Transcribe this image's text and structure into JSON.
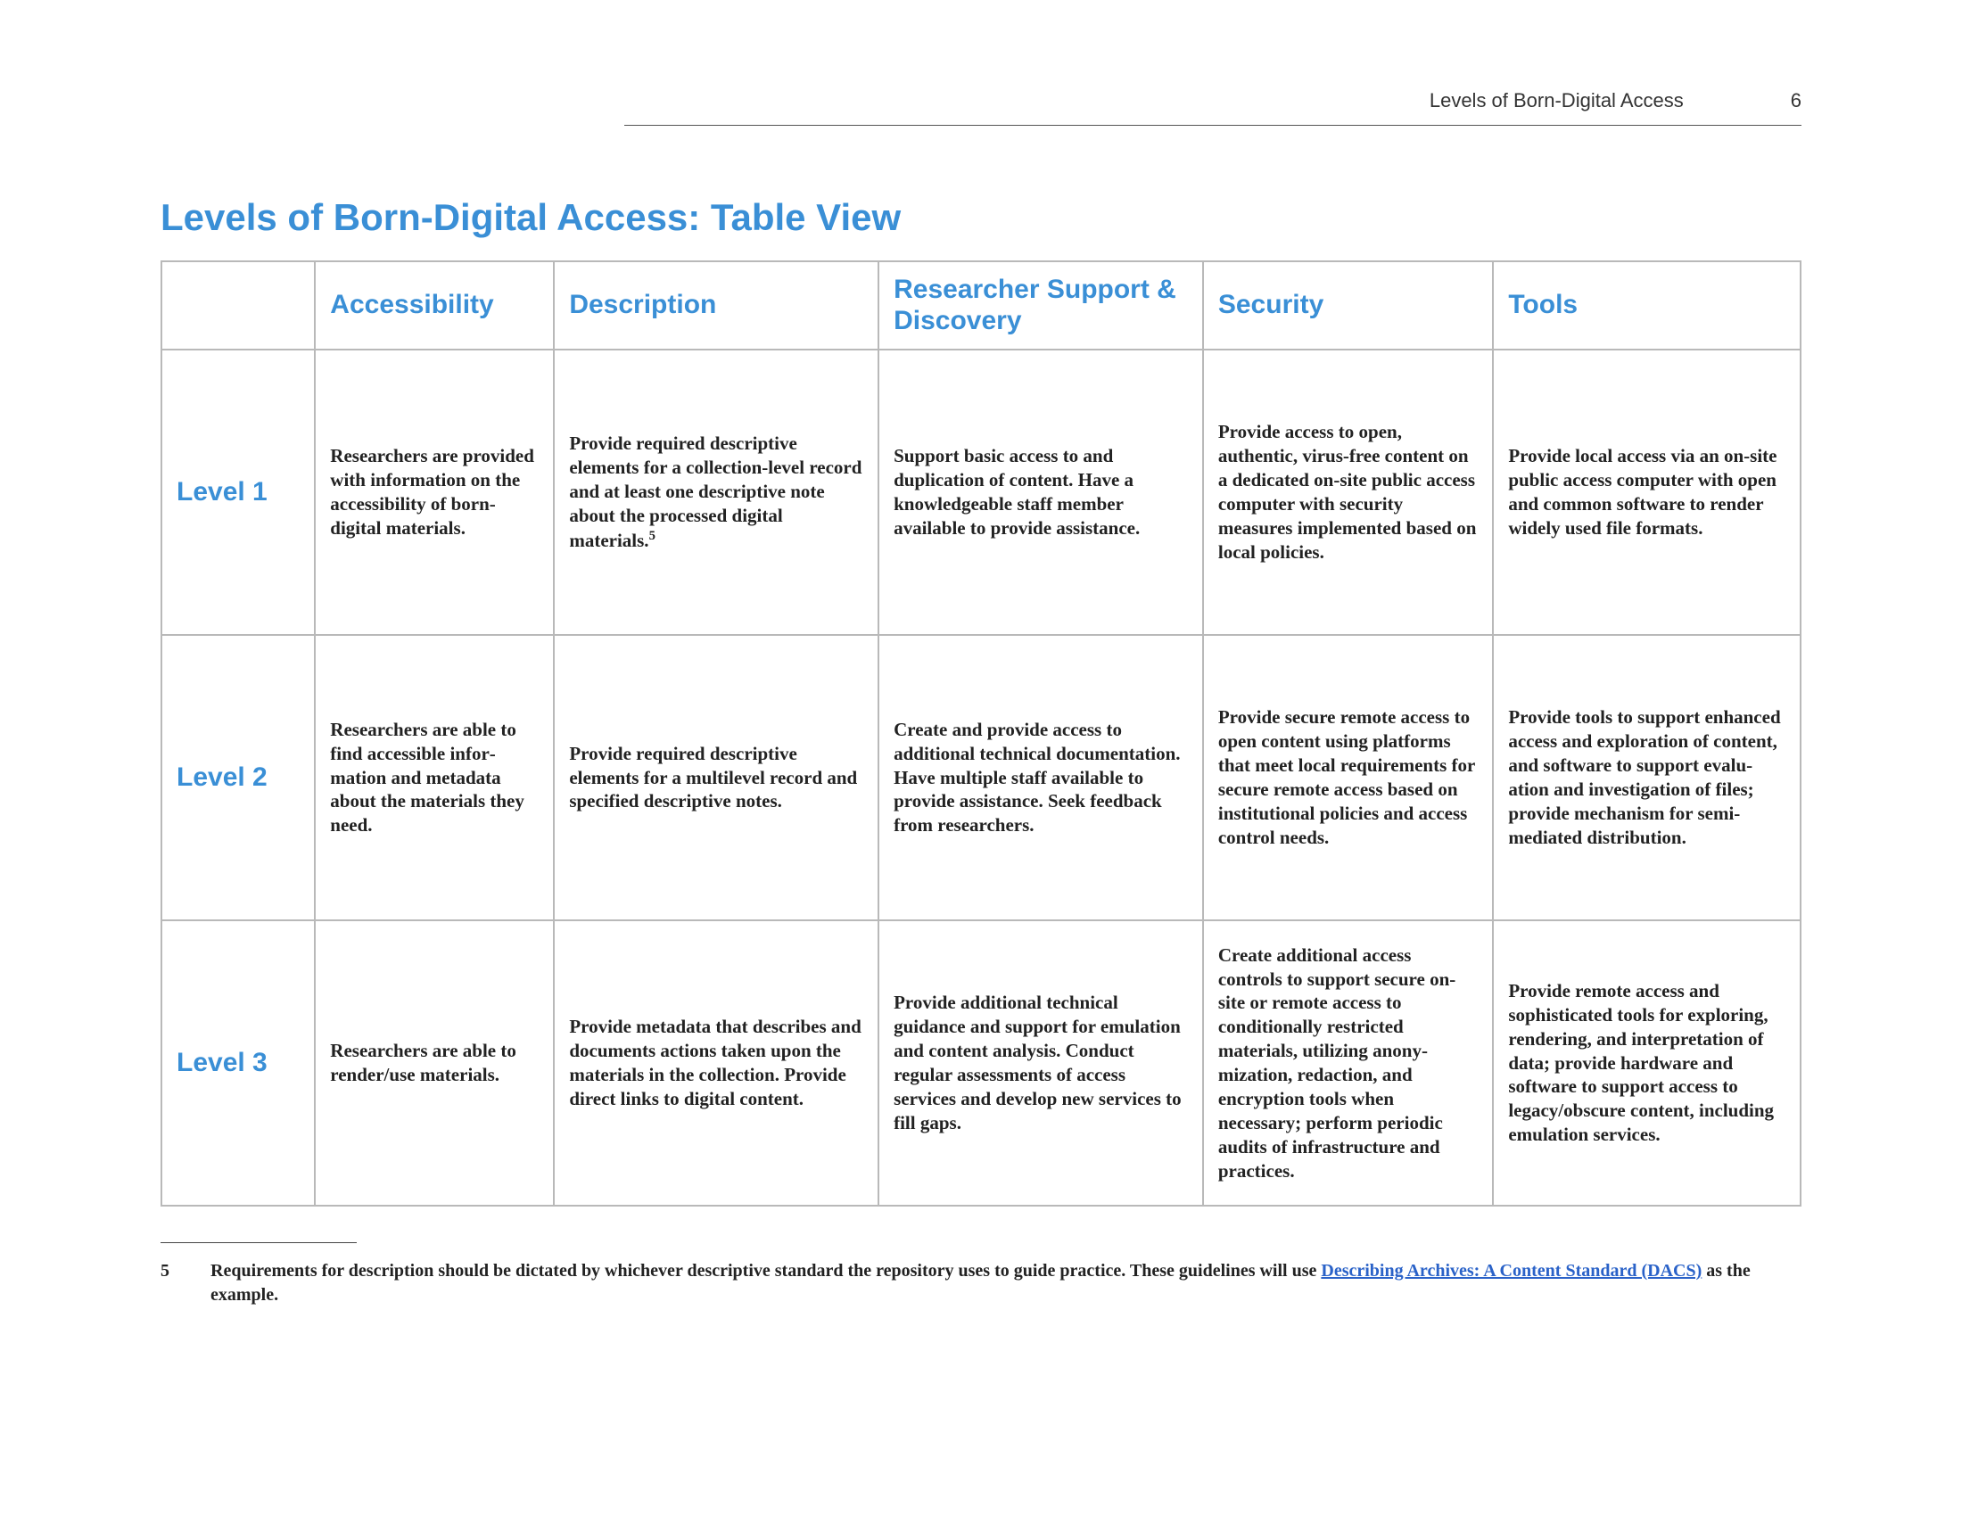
{
  "header": {
    "running_title": "Levels of Born-Digital Access",
    "page_number": "6"
  },
  "title": "Levels of Born-Digital Access: Table View",
  "columns": [
    "Accessibility",
    "Description",
    "Researcher Support & Discovery",
    "Security",
    "Tools"
  ],
  "rows": [
    {
      "label": "Level 1",
      "cells": {
        "accessibility": "Researchers are pro­vided with information on the accessibility of born-digital materials.",
        "description_pre": "Provide required descriptive elements for a collection-level record and at least one descrip­tive note about the processed digital materials.",
        "description_fn": "5",
        "researcher": "Support basic access to and duplication of content. Have a knowledgeable staff member available to provide assistance.",
        "security": "Provide access to open, authentic, virus-free con­tent on a dedicated on-site public access computer with security measures implemented based on local policies.",
        "tools": "Provide local access via an on-site public access computer with open and common software to render widely used file formats."
      }
    },
    {
      "label": "Level 2",
      "cells": {
        "accessibility": "Researchers are able to find accessible infor­mation and metadata about the materials they need.",
        "description_pre": "Provide required descriptive elements for a multilevel record and specified descriptive notes.",
        "description_fn": "",
        "researcher": "Create and provide access to additional technical documenta­tion. Have multiple staff avail­able to provide assistance. Seek feedback from researchers.",
        "security": "Provide secure remote ac­cess to open content using platforms that meet local requirements for secure remote access based on institutional policies and access control needs.",
        "tools": "Provide tools to support enhanced access and ex­ploration of content, and software to support evalu­ation and investigation of files; provide mechanism for semi-mediated distri­bution."
      }
    },
    {
      "label": "Level 3",
      "cells": {
        "accessibility": "Researchers are able to render/use materials.",
        "description_pre": "Provide metadata that describes and documents actions taken upon the materials in the col­lection. Provide direct links to digital content.",
        "description_fn": "",
        "researcher": "Provide additional technical guidance and support for emulation and content analysis. Conduct regular assessments of access services and develop new services to fill gaps.",
        "security": "Create additional access controls to support secure on-site or remote access to conditionally restricted materials, utilizing anony­mization, redaction, and encryption tools when necessary; perform periodic audits of infrastructure and practices.",
        "tools": "Provide remote access and sophisticated tools for exploring, rendering, and interpretation of data; provide hardware and software to support access to legacy/obscure con­tent, including emulation services."
      }
    }
  ],
  "footnote": {
    "marker": "5",
    "text_pre": "Requirements for description should be dictated by whichever descriptive standard the repository uses to guide practice. These guidelines will use ",
    "link_text": "Describing Archives: A Content Standard (DACS)",
    "text_post": " as the example."
  }
}
